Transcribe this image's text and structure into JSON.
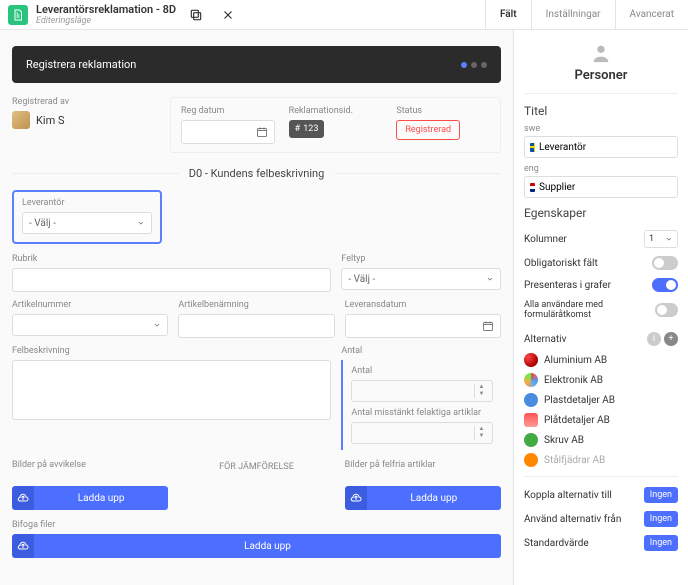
{
  "topbar": {
    "title": "Leverantörsreklamation - 8D",
    "subtitle": "Editeringsläge",
    "tabs": {
      "fields": "Fält",
      "settings": "Inställningar",
      "advanced": "Avancerat"
    }
  },
  "header": {
    "title": "Registrera reklamation"
  },
  "form": {
    "registered_by_label": "Registrerad av",
    "registered_by_value": "Kim S",
    "reg_date_label": "Reg datum",
    "claim_id_label": "Reklamationsid.",
    "claim_id_value": "123",
    "claim_id_prefix": "#",
    "status_label": "Status",
    "status_value": "Registrerad",
    "d0_title": "D0 - Kundens felbeskrivning",
    "supplier_label": "Leverantör",
    "supplier_value": "- Välj -",
    "rubrik_label": "Rubrik",
    "feltyp_label": "Feltyp",
    "feltyp_value": "- Välj -",
    "artnr_label": "Artikelnummer",
    "artben_label": "Artikelbenämning",
    "levdatum_label": "Leveransdatum",
    "felbeskr_label": "Felbeskrivning",
    "antal_label": "Antal",
    "antal_inner_label": "Antal",
    "suspect_label": "Antal misstänkt felaktiga artiklar",
    "bilder_avvik_label": "Bilder på avvikelse",
    "for_jamforelse": "FÖR JÄMFÖRELSE",
    "bilder_felfria_label": "Bilder på felfria artiklar",
    "bifoga_label": "Bifoga filer",
    "upload_text": "Ladda upp"
  },
  "right": {
    "personer": "Personer",
    "titel": "Titel",
    "lang_swe_label": "swe",
    "lang_swe_value": "Leverantör",
    "lang_eng_label": "eng",
    "lang_eng_value": "Supplier",
    "egenskaper": "Egenskaper",
    "kolumner": "Kolumner",
    "kolumner_value": "1",
    "obligatoriskt": "Obligatoriskt fält",
    "presenteras": "Presenteras i grafer",
    "alla_anvandare": "Alla användare med formuläråtkomst",
    "alternativ": "Alternativ",
    "alt_items": [
      {
        "name": "Aluminium AB"
      },
      {
        "name": "Elektronik AB"
      },
      {
        "name": "Plastdetaljer AB"
      },
      {
        "name": "Plåtdetaljer AB"
      },
      {
        "name": "Skruv AB"
      },
      {
        "name": "Stålfjädrar AB"
      }
    ],
    "koppla": "Koppla alternativ till",
    "anvand": "Använd alternativ från",
    "standard": "Standardvärde",
    "ingen": "Ingen"
  }
}
